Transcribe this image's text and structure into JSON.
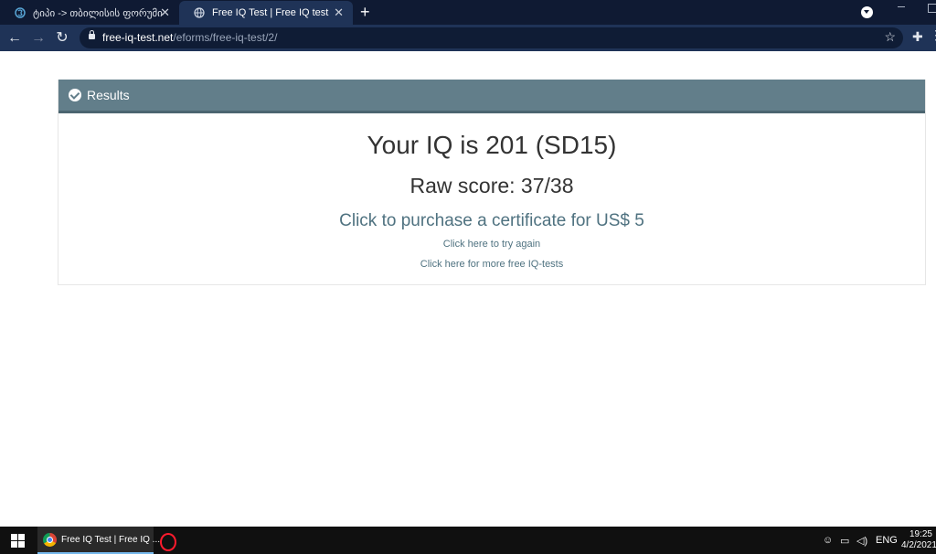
{
  "browser": {
    "tabs": [
      {
        "label": "ტიპი -> თბილისის ფორუმი",
        "close": "✕"
      },
      {
        "label": "Free IQ Test | Free IQ test",
        "close": "✕"
      }
    ],
    "new_tab": "+",
    "url_host": "free-iq-test.net",
    "url_path": "/eforms/free-iq-test/2/"
  },
  "panel": {
    "title": "Results",
    "iq_text": "Your IQ is 201 (SD15)",
    "raw_text": "Raw score: 37/38",
    "purchase_link": "Click to purchase a certificate for US$ 5",
    "try_again_link": "Click here to try again",
    "more_tests_link": "Click here for more free IQ-tests"
  },
  "taskbar": {
    "chrome_label": "Free IQ Test | Free IQ ...",
    "language": "ENG",
    "time": "19:25",
    "date": "4/2/2021"
  },
  "colors": {
    "panel_header": "#627e8a",
    "link": "#4f7280",
    "browser_frame": "#1f3357"
  }
}
